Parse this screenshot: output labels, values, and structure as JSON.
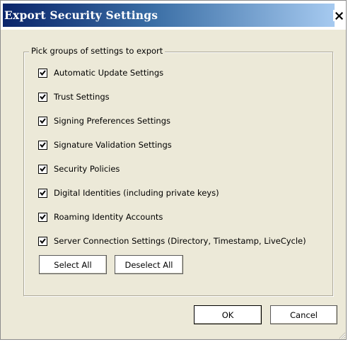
{
  "window": {
    "title": "Export Security Settings",
    "title_color": "#ffffff",
    "titlebar_gradient": [
      "#0a246a",
      "#3a6ea5",
      "#a6caf0"
    ]
  },
  "group": {
    "legend": "Pick groups of settings to export",
    "items": [
      {
        "label": "Automatic Update Settings",
        "checked": true
      },
      {
        "label": "Trust Settings",
        "checked": true
      },
      {
        "label": "Signing Preferences Settings",
        "checked": true
      },
      {
        "label": "Signature Validation Settings",
        "checked": true
      },
      {
        "label": "Security Policies",
        "checked": true
      },
      {
        "label": "Digital Identities (including private keys)",
        "checked": true
      },
      {
        "label": "Roaming Identity Accounts",
        "checked": true
      },
      {
        "label": "Server Connection Settings (Directory, Timestamp, LiveCycle)",
        "checked": true
      }
    ],
    "select_all_label": "Select All",
    "deselect_all_label": "Deselect All"
  },
  "footer": {
    "ok_label": "OK",
    "cancel_label": "Cancel"
  },
  "icons": {
    "close": "close-icon",
    "check": "checkmark-icon",
    "grip": "resize-grip-icon"
  },
  "colors": {
    "dialog_background": "#ece9d8",
    "group_border": "#aca899"
  }
}
